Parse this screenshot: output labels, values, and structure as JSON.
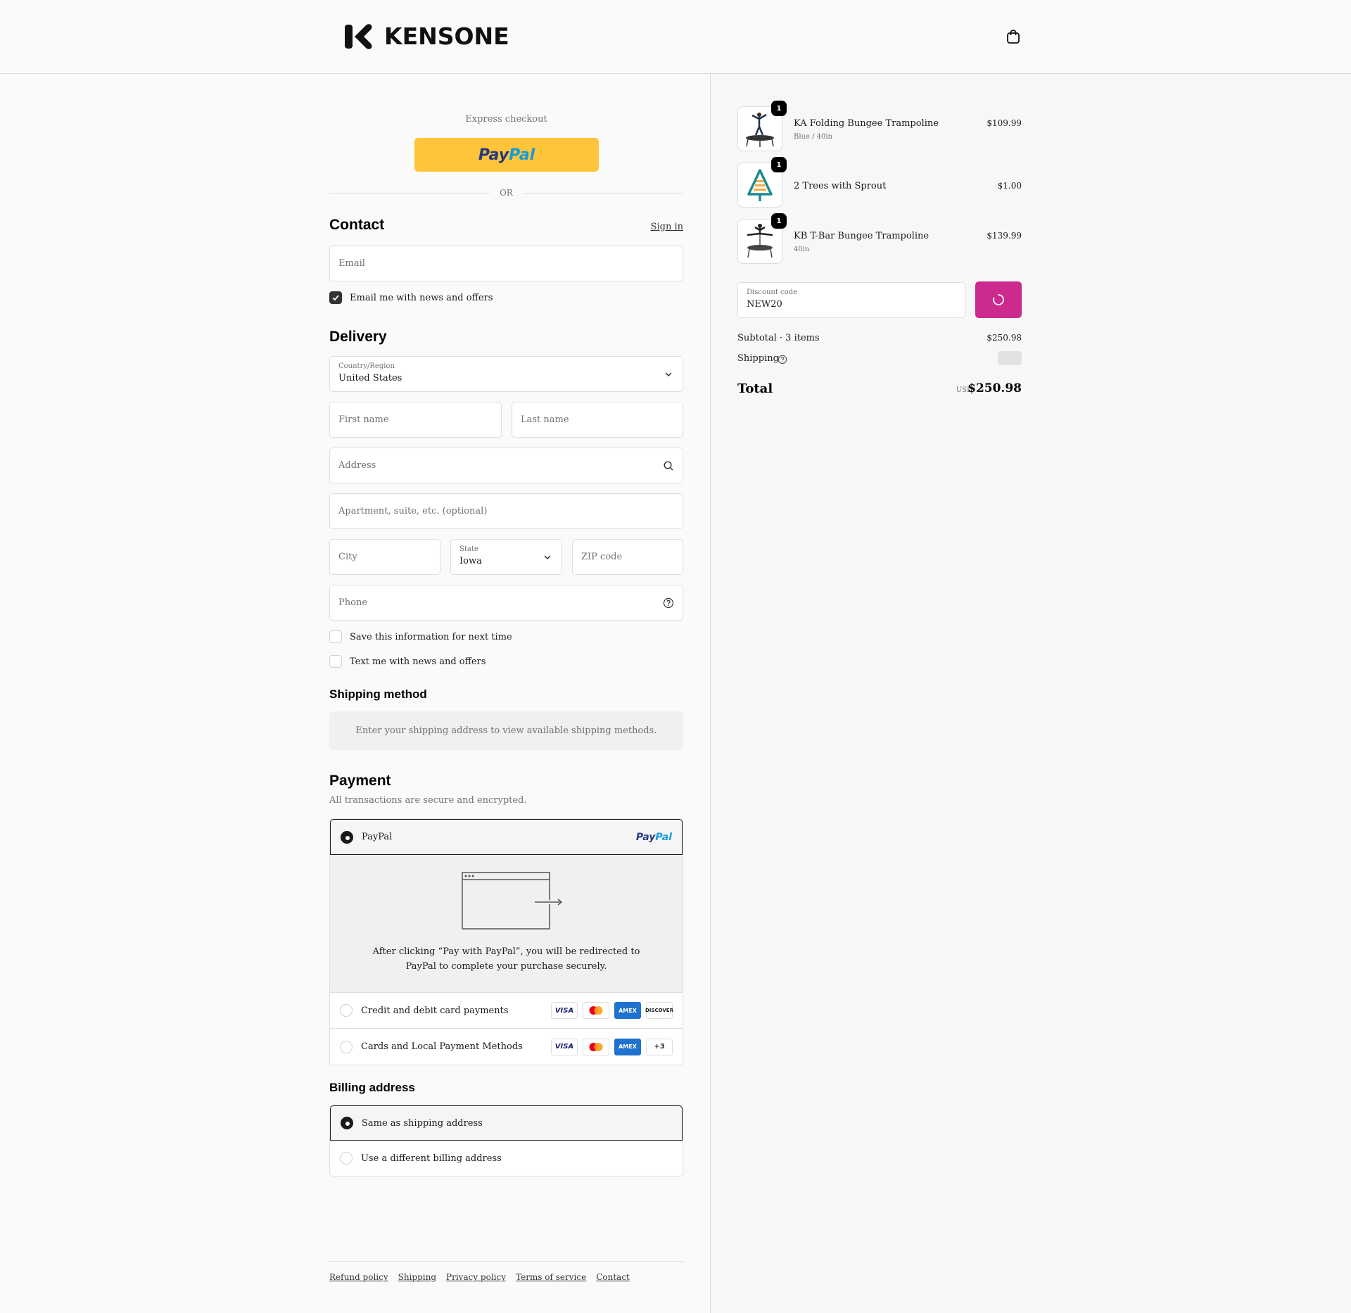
{
  "header": {
    "brand": "KENSONE",
    "cart_icon": "shopping-bag-icon"
  },
  "express": {
    "label": "Express checkout",
    "paypal_button": {
      "part1": "Pay",
      "part2": "Pal"
    },
    "or": "OR"
  },
  "contact": {
    "title": "Contact",
    "sign_in": "Sign in",
    "email_placeholder": "Email",
    "news_checkbox": {
      "label": "Email me with news and offers",
      "checked": true
    }
  },
  "delivery": {
    "title": "Delivery",
    "country": {
      "label": "Country/Region",
      "value": "United States"
    },
    "first_name_placeholder": "First name",
    "last_name_placeholder": "Last name",
    "address_placeholder": "Address",
    "apartment_placeholder": "Apartment, suite, etc. (optional)",
    "city_placeholder": "City",
    "state": {
      "label": "State",
      "value": "Iowa"
    },
    "zip_placeholder": "ZIP code",
    "phone_placeholder": "Phone",
    "save_info": {
      "label": "Save this information for next time",
      "checked": false
    },
    "text_me": {
      "label": "Text me with news and offers",
      "checked": false
    }
  },
  "shipping_method": {
    "title": "Shipping method",
    "notice": "Enter your shipping address to view available shipping methods."
  },
  "payment": {
    "title": "Payment",
    "subtitle": "All transactions are secure and encrypted.",
    "options": [
      {
        "label": "PayPal",
        "selected": true
      },
      {
        "label": "Credit and debit card payments",
        "selected": false,
        "cards": [
          "VISA",
          "mastercard",
          "AMEX",
          "DISCOVER"
        ]
      },
      {
        "label": "Cards and Local Payment Methods",
        "selected": false,
        "cards": [
          "VISA",
          "mastercard",
          "AMEX",
          "+3"
        ]
      }
    ],
    "paypal_redirect_line1": "After clicking “Pay with PayPal”, you will be redirected to",
    "paypal_redirect_line2": "PayPal to complete your purchase securely."
  },
  "billing": {
    "title": "Billing address",
    "options": [
      {
        "label": "Same as shipping address",
        "selected": true
      },
      {
        "label": "Use a different billing address",
        "selected": false
      }
    ]
  },
  "footer": {
    "links": [
      "Refund policy",
      "Shipping",
      "Privacy policy",
      "Terms of service",
      "Contact"
    ]
  },
  "order": {
    "items": [
      {
        "name": "KA Folding Bungee Trampoline",
        "variant": "Blue / 40in",
        "price": "$109.99",
        "qty": "1"
      },
      {
        "name": "2 Trees with Sprout",
        "variant": "",
        "price": "$1.00",
        "qty": "1"
      },
      {
        "name": "KB T-Bar Bungee Trampoline",
        "variant": "40in",
        "price": "$139.99",
        "qty": "1"
      }
    ],
    "discount": {
      "label": "Discount code",
      "value": "NEW20"
    },
    "subtotal_label": "Subtotal · 3 items",
    "subtotal_value": "$250.98",
    "shipping_label": "Shipping",
    "total_label": "Total",
    "currency": "USD",
    "total_value": "$250.98",
    "accent_color": "#cc2a8e"
  }
}
